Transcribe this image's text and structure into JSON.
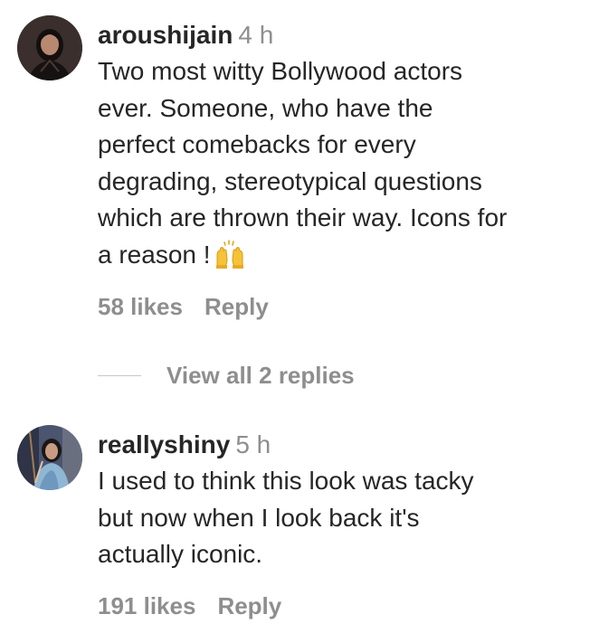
{
  "comments": [
    {
      "username": "aroushijain",
      "time": "4 h",
      "lines": [
        "Two most witty Bollywood actors",
        "ever. Someone, who have the",
        "perfect comebacks for every",
        "degrading, stereotypical questions",
        "which are thrown their way. Icons for",
        "a reason !"
      ],
      "emoji": "raising-hands-emoji",
      "likes": "58 likes",
      "reply": "Reply",
      "view_replies": "View all 2 replies"
    },
    {
      "username": "reallyshiny",
      "time": "5 h",
      "lines": [
        "I used to think this look was tacky",
        "but now when I look back it's",
        "actually iconic."
      ],
      "likes": "191 likes",
      "reply": "Reply"
    }
  ],
  "colors": {
    "primary_text": "#262626",
    "secondary_text": "#8e8e8e",
    "background": "#ffffff"
  }
}
